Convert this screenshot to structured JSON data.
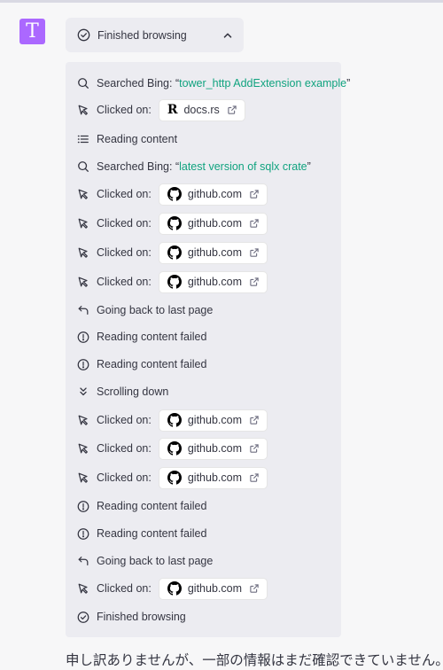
{
  "avatar": {
    "letter": "T",
    "color": "#ab68ff"
  },
  "header": {
    "label": "Finished browsing",
    "icon": "check-circle-icon",
    "toggle_icon": "chevron-up-icon"
  },
  "accent": "#10a37f",
  "steps": [
    {
      "type": "search",
      "icon": "search-icon",
      "label": "Searched Bing: “",
      "query": "tower_http AddExtension example",
      "close": "”"
    },
    {
      "type": "click",
      "icon": "cursor-icon",
      "label": "Clicked on:",
      "site": "docs.rs",
      "site_icon": "rust-docs-icon"
    },
    {
      "type": "text",
      "icon": "list-icon",
      "label": "Reading content"
    },
    {
      "type": "search",
      "icon": "search-icon",
      "label": "Searched Bing: “",
      "query": "latest version of sqlx crate",
      "close": "”"
    },
    {
      "type": "click",
      "icon": "cursor-icon",
      "label": "Clicked on:",
      "site": "github.com",
      "site_icon": "github-icon"
    },
    {
      "type": "click",
      "icon": "cursor-icon",
      "label": "Clicked on:",
      "site": "github.com",
      "site_icon": "github-icon"
    },
    {
      "type": "click",
      "icon": "cursor-icon",
      "label": "Clicked on:",
      "site": "github.com",
      "site_icon": "github-icon"
    },
    {
      "type": "click",
      "icon": "cursor-icon",
      "label": "Clicked on:",
      "site": "github.com",
      "site_icon": "github-icon"
    },
    {
      "type": "text",
      "icon": "back-arrow-icon",
      "label": "Going back to last page"
    },
    {
      "type": "text",
      "icon": "alert-circle-icon",
      "label": "Reading content failed"
    },
    {
      "type": "text",
      "icon": "alert-circle-icon",
      "label": "Reading content failed"
    },
    {
      "type": "text",
      "icon": "chevrons-down-icon",
      "label": "Scrolling down"
    },
    {
      "type": "click",
      "icon": "cursor-icon",
      "label": "Clicked on:",
      "site": "github.com",
      "site_icon": "github-icon"
    },
    {
      "type": "click",
      "icon": "cursor-icon",
      "label": "Clicked on:",
      "site": "github.com",
      "site_icon": "github-icon"
    },
    {
      "type": "click",
      "icon": "cursor-icon",
      "label": "Clicked on:",
      "site": "github.com",
      "site_icon": "github-icon"
    },
    {
      "type": "text",
      "icon": "alert-circle-icon",
      "label": "Reading content failed"
    },
    {
      "type": "text",
      "icon": "alert-circle-icon",
      "label": "Reading content failed"
    },
    {
      "type": "text",
      "icon": "back-arrow-icon",
      "label": "Going back to last page"
    },
    {
      "type": "click",
      "icon": "cursor-icon",
      "label": "Clicked on:",
      "site": "github.com",
      "site_icon": "github-icon"
    },
    {
      "type": "text",
      "icon": "check-circle-icon",
      "label": "Finished browsing"
    }
  ],
  "response_text": "申し訳ありませんが、一部の情報はまだ確認できていません。"
}
